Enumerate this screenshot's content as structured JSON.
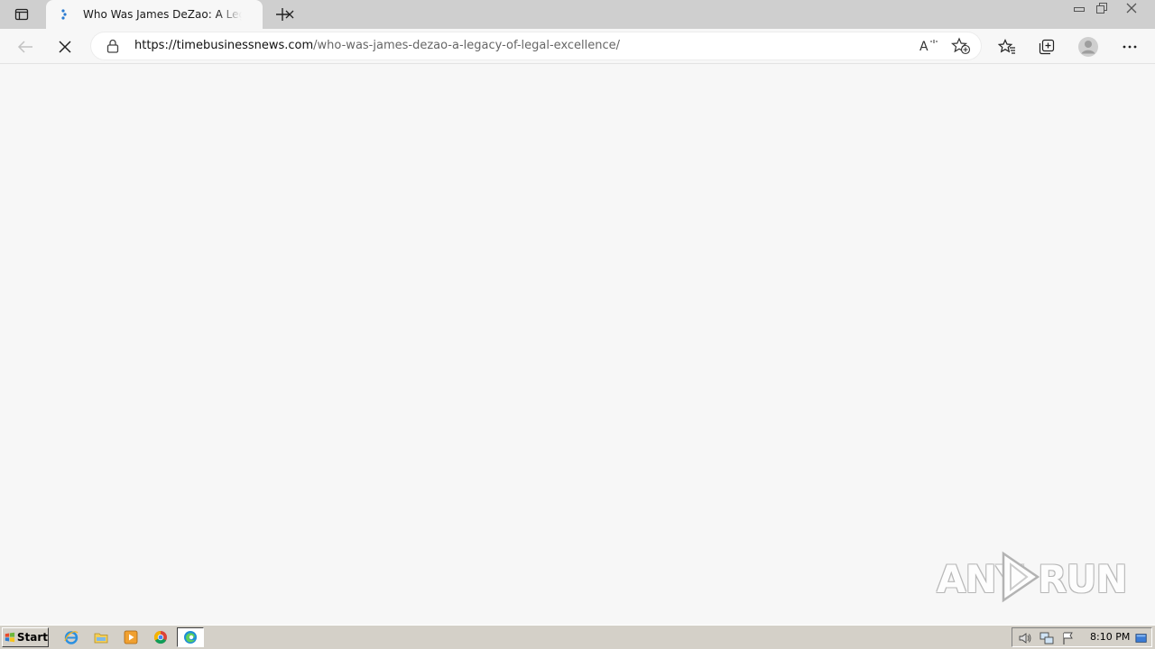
{
  "tab": {
    "title": "Who Was James DeZao: A Legacy of Legal Excellence"
  },
  "addressbar": {
    "url_host": "https://timebusinessnews.com",
    "url_path": "/who-was-james-dezao-a-legacy-of-legal-excellence/"
  },
  "watermark": {
    "left": "ANY",
    "right": "RUN"
  },
  "taskbar": {
    "start_label": "Start",
    "clock": "8:10 PM"
  },
  "colors": {
    "titlebar": "#cfcfcf",
    "page_background": "#f7f7f7",
    "taskbar": "#d4d0c8",
    "favicon_accent": "#2a7bd1"
  },
  "icons": {
    "tab_actions": "tab-actions-icon",
    "close": "close-icon",
    "new_tab": "plus-icon",
    "back": "back-arrow-icon",
    "stop": "stop-loading-icon",
    "lock": "lock-icon",
    "read_aloud": "read-aloud-icon",
    "add_favorite": "add-favorite-icon",
    "favorites": "favorites-icon",
    "collections": "collections-icon",
    "profile": "profile-icon",
    "more": "more-icon"
  }
}
